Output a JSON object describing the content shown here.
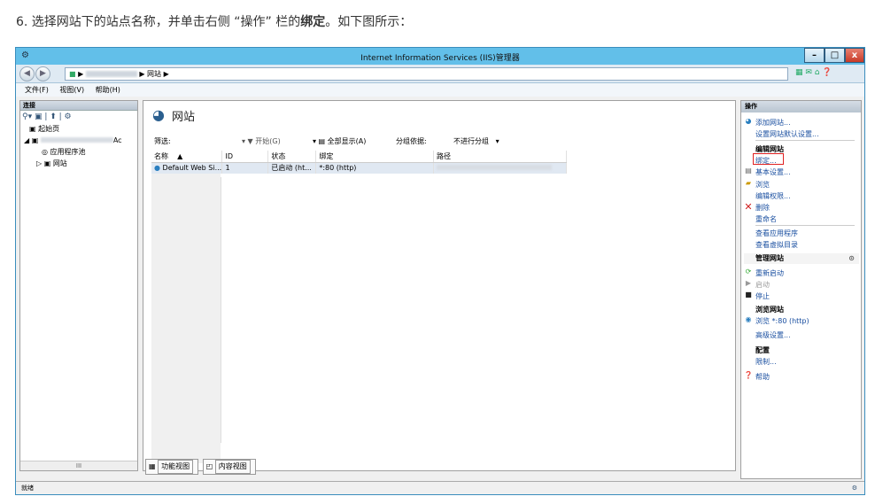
{
  "caption": {
    "prefix": "6. 选择网站下的站点名称，并单击右侧 “操作” 栏的",
    "bold": "绑定",
    "suffix": "。如下图所示："
  },
  "window": {
    "title": "Internet Information Services (IIS)管理器",
    "min": "–",
    "max": "□",
    "close": "x"
  },
  "address": {
    "segment1": "▶",
    "segment2": "▶ 网站 ▶"
  },
  "menu": [
    "文件(F)",
    "视图(V)",
    "帮助(H)"
  ],
  "left": {
    "header": "连接",
    "tree": [
      {
        "label": "起始页",
        "indent": 1
      },
      {
        "label": "Ac",
        "indent": 1
      },
      {
        "label": "应用程序池",
        "indent": 2
      },
      {
        "label": "网站",
        "indent": 2
      }
    ],
    "scroll": "III"
  },
  "center": {
    "title": "网站",
    "filter": {
      "label": "筛选:",
      "start": "开始(G)",
      "show_all": "全部显示(A)",
      "group_by": "分组依据:",
      "group_value": "不进行分组"
    },
    "columns": [
      "名称",
      "ID",
      "状态",
      "绑定",
      "路径"
    ],
    "rows": [
      {
        "name": "Default Web Si...",
        "id": "1",
        "status": "已启动 (ht...",
        "binding": "*:80 (http)",
        "path": ""
      }
    ],
    "tabs": [
      "功能视图",
      "内容视图"
    ]
  },
  "right": {
    "header": "操作",
    "add_site": "添加网站...",
    "defaults": "设置网站默认设置...",
    "edit_site": "编辑网站",
    "bindings": "绑定...",
    "basic": "基本设置...",
    "browse": "浏览",
    "perms": "编辑权限...",
    "delete": "删除",
    "rename": "重命名",
    "view_apps": "查看应用程序",
    "view_vdirs": "查看虚拟目录",
    "manage_site": "管理网站",
    "restart": "重新启动",
    "start": "启动",
    "stop": "停止",
    "browse_site": "浏览网站",
    "browse_80": "浏览 *:80 (http)",
    "advanced": "高级设置...",
    "config": "配置",
    "limits": "限制...",
    "help": "帮助"
  },
  "status": "就绪",
  "colors": {
    "accent": "#62bfe9",
    "link": "#1a4fa0",
    "highlight": "#e02020"
  }
}
